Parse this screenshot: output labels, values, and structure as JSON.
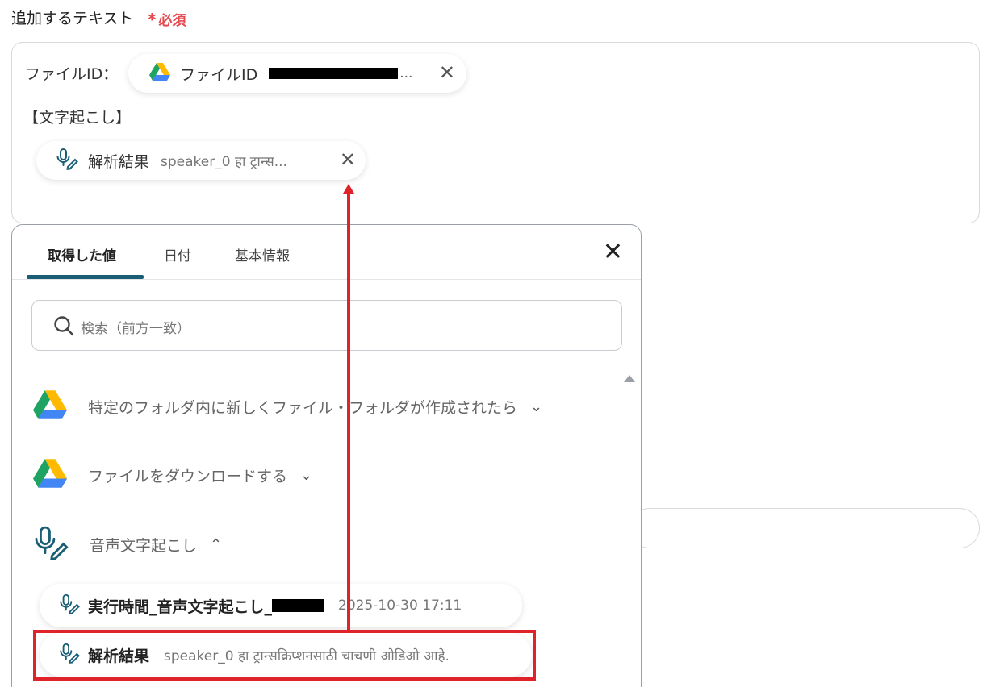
{
  "field": {
    "label": "追加するテキスト",
    "required_mark": "*",
    "required_text": "必須"
  },
  "editor": {
    "line1_prefix": "ファイルID：",
    "file_pill": {
      "label": "ファイルID",
      "ellipsis": "..."
    },
    "line2": "【文字起こし】",
    "result_pill": {
      "label": "解析結果",
      "value": "speaker_0 हा ट्रान्स..."
    }
  },
  "panel": {
    "tabs": [
      "取得した値",
      "日付",
      "基本情報"
    ],
    "search_placeholder": "検索（前方一致）",
    "groups": [
      {
        "name": "特定のフォルダ内に新しくファイル・フォルダが作成されたら",
        "chevron": "⌄"
      },
      {
        "name": "ファイルをダウンロードする",
        "chevron": "⌄"
      },
      {
        "name": "音声文字起こし",
        "chevron": "⌃"
      }
    ],
    "items": [
      {
        "label": "実行時間_音声文字起こし_",
        "value": "2025-10-30 17:11"
      },
      {
        "label": "解析結果",
        "value": "speaker_0 हा ट्रान्सक्रिप्शनसाठी चाचणी ओडिओ आहे."
      }
    ]
  },
  "colors": {
    "accent_tab": "#1a5e76",
    "required": "#e5484d",
    "annotation": "#e0232b",
    "drive_green": "#1ea362",
    "drive_blue": "#4285f4",
    "drive_yellow": "#ffba00",
    "mic_icon": "#1a5e76"
  },
  "icons": [
    "google-drive-icon",
    "mic-pen-icon",
    "close-icon",
    "search-icon",
    "chevron-down-icon",
    "chevron-up-icon"
  ]
}
